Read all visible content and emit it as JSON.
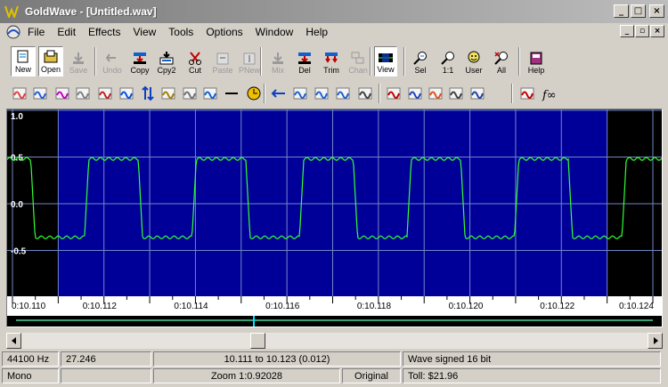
{
  "window": {
    "title": "GoldWave - [Untitled.wav]",
    "minimize": "_",
    "maximize": "□",
    "close": "×"
  },
  "menu": [
    "File",
    "Edit",
    "Effects",
    "View",
    "Tools",
    "Options",
    "Window",
    "Help"
  ],
  "mdi": {
    "minimize": "_",
    "restore": "▫",
    "close": "×"
  },
  "toolbar": [
    {
      "label": "New",
      "icon": "new-icon",
      "enabled": true
    },
    {
      "label": "Open",
      "icon": "open-icon",
      "enabled": true
    },
    {
      "label": "Save",
      "icon": "save-icon",
      "enabled": false
    },
    {
      "label": "Undo",
      "icon": "undo-icon",
      "enabled": false
    },
    {
      "label": "Copy",
      "icon": "copy-icon",
      "enabled": true
    },
    {
      "label": "Cpy2",
      "icon": "copy2-icon",
      "enabled": true
    },
    {
      "label": "Cut",
      "icon": "cut-icon",
      "enabled": true
    },
    {
      "label": "Paste",
      "icon": "paste-icon",
      "enabled": false
    },
    {
      "label": "PNew",
      "icon": "paste-new-icon",
      "enabled": false
    },
    {
      "label": "Mix",
      "icon": "mix-icon",
      "enabled": false
    },
    {
      "label": "Del",
      "icon": "delete-icon",
      "enabled": true
    },
    {
      "label": "Trim",
      "icon": "trim-icon",
      "enabled": true
    },
    {
      "label": "Chan",
      "icon": "channel-icon",
      "enabled": false
    },
    {
      "label": "View",
      "icon": "view-icon",
      "enabled": true
    },
    {
      "label": "Sel",
      "icon": "zoom-selection-icon",
      "enabled": true
    },
    {
      "label": "1:1",
      "icon": "zoom-1-1-icon",
      "enabled": true
    },
    {
      "label": "User",
      "icon": "zoom-user-icon",
      "enabled": true
    },
    {
      "label": "All",
      "icon": "zoom-all-icon",
      "enabled": true
    },
    {
      "label": "Help",
      "icon": "help-book-icon",
      "enabled": true
    }
  ],
  "effects_toolbar_icons": [
    "auto-gain-icon",
    "doppler-icon",
    "echo-icon",
    "dynamics-icon",
    "mechanize-icon",
    "flanger-icon",
    "invert-icon",
    "equalizer-icon",
    "filter-icon",
    "offset-icon",
    "silence-icon",
    "time-warp-icon",
    "reverse-icon",
    "pan-icon",
    "resample-icon",
    "transpose-icon",
    "interpolate-icon",
    "bandpass-icon",
    "lowhigh-icon",
    "parametric-icon",
    "spectrum-icon",
    "noise-icon",
    "marker-icon",
    "function-icon"
  ],
  "colors": {
    "wave_bg": "#000000",
    "selection_bg": "#000099",
    "waveform": "#33ff33",
    "grid": "#6f88c4"
  },
  "waveform": {
    "y_labels": [
      "1.0",
      "0.5",
      "0.0",
      "-0.5"
    ],
    "time_labels": [
      "0:10.110",
      "0:10.112",
      "0:10.114",
      "0:10.116",
      "0:10.118",
      "0:10.120",
      "0:10.122",
      "0:10.124"
    ],
    "selection_start": 10.111,
    "selection_end": 10.123,
    "view_start": 10.11,
    "view_end": 10.124
  },
  "status": {
    "rate": "44100 Hz",
    "length": "27.246",
    "selection": "10.111 to 10.123  (0.012)",
    "format": "Wave signed 16 bit",
    "channel": "Mono",
    "zoom": "Zoom 1:0.92028",
    "state": "Original",
    "toll": "Toll: $21.96"
  }
}
